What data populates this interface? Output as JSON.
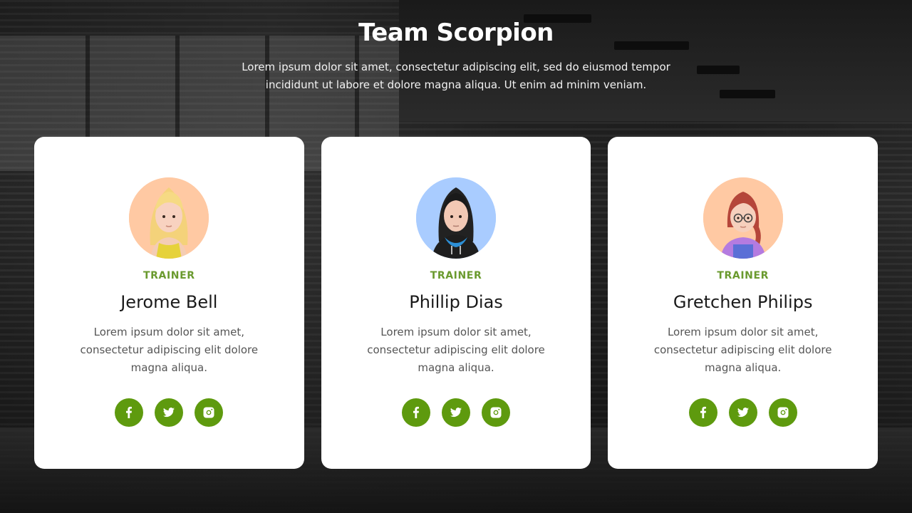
{
  "section": {
    "title": "Team Scorpion",
    "subtitle": "Lorem ipsum dolor sit amet, consectetur adipiscing elit, sed do eiusmod tempor incididunt ut labore et dolore magna aliqua. Ut enim ad minim veniam."
  },
  "colors": {
    "accent": "#5e9a0e",
    "role_text": "#6a9a2e",
    "card_bg": "#ffffff"
  },
  "members": [
    {
      "role": "TRAINER",
      "name": "Jerome Bell",
      "bio": "Lorem ipsum dolor sit amet, consectetur adipiscing elit dolore magna aliqua.",
      "avatar": "avatar-blonde-woman",
      "avatar_bg": "#ffc9a3",
      "socials": [
        "facebook-icon",
        "twitter-icon",
        "instagram-icon"
      ]
    },
    {
      "role": "TRAINER",
      "name": "Phillip Dias",
      "bio": "Lorem ipsum dolor sit amet, consectetur adipiscing elit dolore magna aliqua.",
      "avatar": "avatar-dark-hair-hoodie",
      "avatar_bg": "#a9ccff",
      "socials": [
        "facebook-icon",
        "twitter-icon",
        "instagram-icon"
      ]
    },
    {
      "role": "TRAINER",
      "name": "Gretchen Philips",
      "bio": "Lorem ipsum dolor sit amet, consectetur adipiscing elit dolore magna aliqua.",
      "avatar": "avatar-glasses-redhead",
      "avatar_bg": "#ffc9a3",
      "socials": [
        "facebook-icon",
        "twitter-icon",
        "instagram-icon"
      ]
    }
  ]
}
